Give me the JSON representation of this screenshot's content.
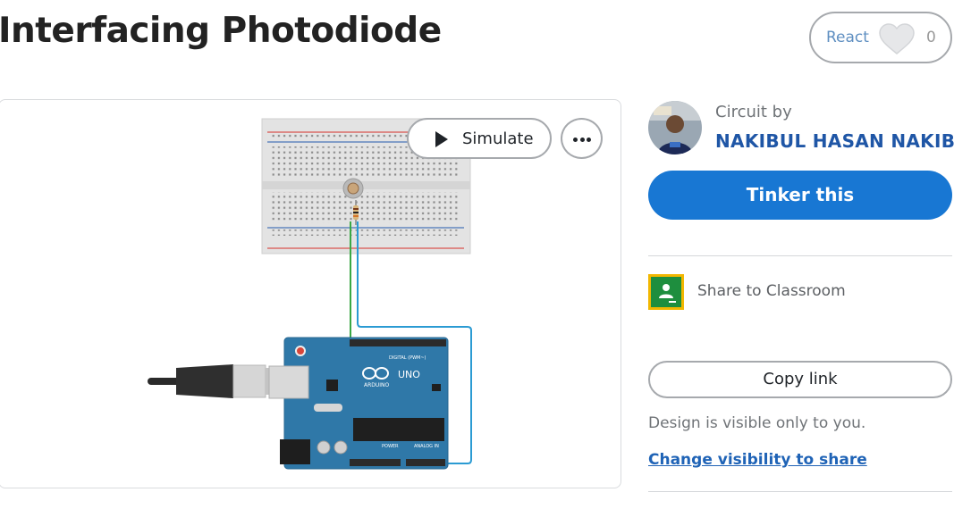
{
  "page": {
    "title": "Interfacing Photodiode"
  },
  "react": {
    "label": "React",
    "count": "0"
  },
  "viewer": {
    "simulate_label": "Simulate",
    "board_label": "UNO",
    "board_brand": "ARDUINO",
    "digital_label": "DIGITAL (PWM~)",
    "power_label": "POWER",
    "analog_label": "ANALOG IN",
    "wire_colors": {
      "green": "#3aa845",
      "blue": "#2b9bd3"
    }
  },
  "sidebar": {
    "circuit_by": "Circuit by",
    "author": "NAKIBUL HASAN NAKIB",
    "tinker_label": "Tinker this",
    "classroom_label": "Share to Classroom",
    "copy_link_label": "Copy link",
    "visibility_note": "Design is visible only to you.",
    "visibility_link": "Change visibility to share"
  },
  "colors": {
    "accent": "#1877d3",
    "author": "#1f56a6",
    "link": "#1f63b6"
  }
}
